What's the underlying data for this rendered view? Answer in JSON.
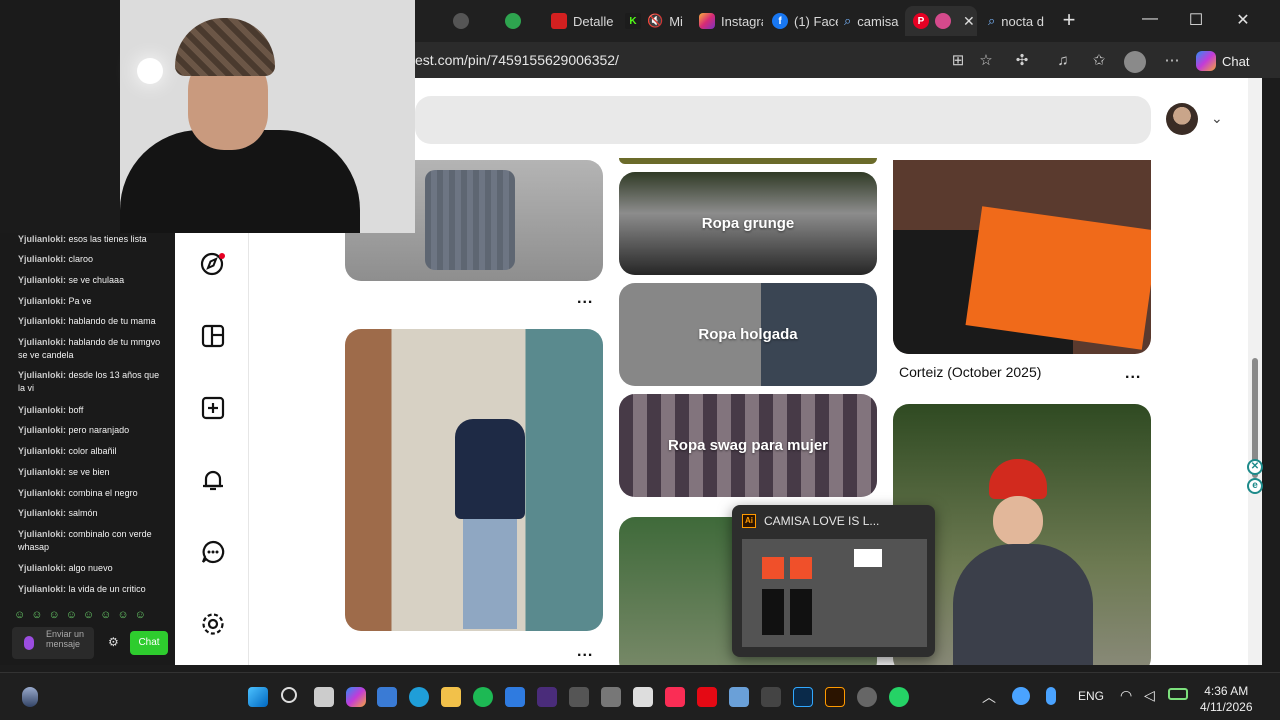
{
  "browser": {
    "tabs": [
      {
        "label": ""
      },
      {
        "label": ""
      },
      {
        "label": "Detalle"
      },
      {
        "label": "Mi"
      },
      {
        "label": "Instagra"
      },
      {
        "label": "(1) Face"
      },
      {
        "label": "camisa"
      },
      {
        "label": ""
      },
      {
        "label": "nocta d"
      }
    ],
    "new_tab_label": "+",
    "url": "est.com/pin/7459155629006352/",
    "copilot_label": "Chat"
  },
  "pinterest": {
    "search_placeholder": "",
    "boards": [
      {
        "label": "Ropa grunge"
      },
      {
        "label": "Ropa holgada"
      },
      {
        "label": "Ropa swag para mujer"
      }
    ],
    "pin_titles": [
      {
        "title": "Corteiz (October 2025)"
      }
    ],
    "more_label": "..."
  },
  "chat": {
    "messages": [
      {
        "user": "Yjulianloki:",
        "text": "esos las tienes lista"
      },
      {
        "user": "Yjulianloki:",
        "text": "claroo"
      },
      {
        "user": "Yjulianloki:",
        "text": "se ve chulaaa"
      },
      {
        "user": "Yjulianloki:",
        "text": "Pa ve"
      },
      {
        "user": "Yjulianloki:",
        "text": "hablando de tu mama"
      },
      {
        "user": "Yjulianloki:",
        "text": "hablando de tu mmgvo se ve candela"
      },
      {
        "user": "Yjulianloki:",
        "text": "desde los 13 años que la vi"
      },
      {
        "user": "Yjulianloki:",
        "text": "boff"
      },
      {
        "user": "Yjulianloki:",
        "text": "pero naranjado"
      },
      {
        "user": "Yjulianloki:",
        "text": "color albañil"
      },
      {
        "user": "Yjulianloki:",
        "text": "se ve bien"
      },
      {
        "user": "Yjulianloki:",
        "text": "combina el negro"
      },
      {
        "user": "Yjulianloki:",
        "text": "salmón"
      },
      {
        "user": "Yjulianloki:",
        "text": "combinalo con verde whasap"
      },
      {
        "user": "Yjulianloki:",
        "text": "algo nuevo"
      },
      {
        "user": "Yjulianloki:",
        "text": "la vida de un critico"
      }
    ],
    "input_placeholder": "Enviar un mensaje",
    "send_label": "Chat"
  },
  "thumbnail": {
    "title": "CAMISA LOVE IS L...",
    "app_badge": "Ai"
  },
  "taskbar": {
    "lang": "ENG",
    "time": "4:36 AM",
    "date": "4/11/2026"
  }
}
